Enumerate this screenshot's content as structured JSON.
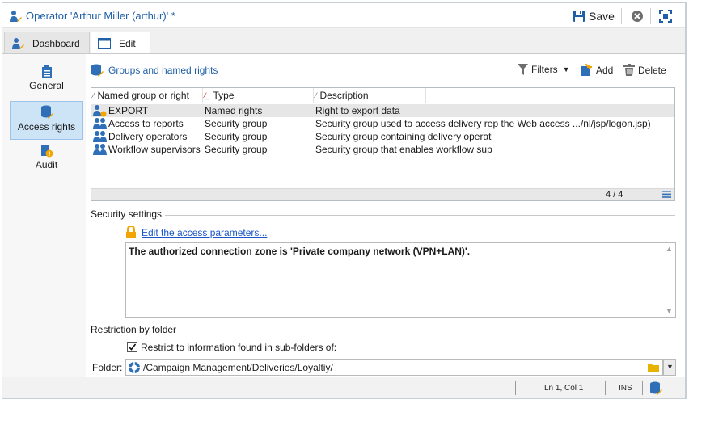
{
  "window": {
    "title": "Operator 'Arthur Miller (arthur)' *",
    "save_label": "Save"
  },
  "tabs": [
    {
      "label": "Dashboard"
    },
    {
      "label": "Edit"
    }
  ],
  "sidebar": {
    "items": [
      {
        "label": "General"
      },
      {
        "label": "Access rights"
      },
      {
        "label": "Audit"
      }
    ]
  },
  "groups_panel": {
    "title": "Groups and named rights",
    "filters_label": "Filters",
    "add_label": "Add",
    "delete_label": "Delete",
    "columns": [
      "Named group or right",
      "Type",
      "Description"
    ],
    "rows": [
      {
        "name": "EXPORT",
        "type": "Named rights",
        "description": "Right to export data",
        "icon": "named-right-icon"
      },
      {
        "name": "Access to reports",
        "type": "Security group",
        "description": "Security group used to access delivery rep the Web access .../nl/jsp/logon.jsp)",
        "icon": "group-icon"
      },
      {
        "name": "Delivery operators",
        "type": "Security group",
        "description": "Security group containing delivery operat",
        "icon": "group-icon"
      },
      {
        "name": "Workflow supervisors",
        "type": "Security group",
        "description": "Security group that enables workflow sup",
        "icon": "group-icon"
      }
    ],
    "count": "4 / 4"
  },
  "security": {
    "section_label": "Security settings",
    "edit_link": "Edit the access parameters...",
    "memo_text": "The authorized connection zone is 'Private company network (VPN+LAN)'."
  },
  "restriction": {
    "section_label": "Restriction by folder",
    "checkbox_label": "Restrict to information found in sub-folders of:",
    "checkbox_checked": true,
    "folder_label": "Folder:",
    "folder_value": "/Campaign Management/Deliveries/Loyaltiy/"
  },
  "statusbar": {
    "position": "Ln 1, Col 1",
    "mode": "INS"
  },
  "colors": {
    "accent": "#1f5fa6",
    "selection": "#cde3f6",
    "link": "#1a56c8"
  }
}
